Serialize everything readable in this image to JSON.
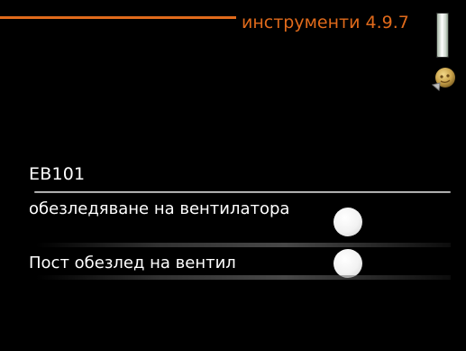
{
  "header": {
    "title": "инструменти 4.9.7",
    "accent_color": "#e06a1b"
  },
  "icons": {
    "scroll_indicator": "scroll-indicator-icon",
    "help": "help-icon"
  },
  "section": {
    "label": "EB101"
  },
  "items": [
    {
      "label": "обезледяване на вентилатора",
      "toggle_state": "off"
    },
    {
      "label": "Пост обезлед на вентил",
      "toggle_state": "off"
    }
  ]
}
